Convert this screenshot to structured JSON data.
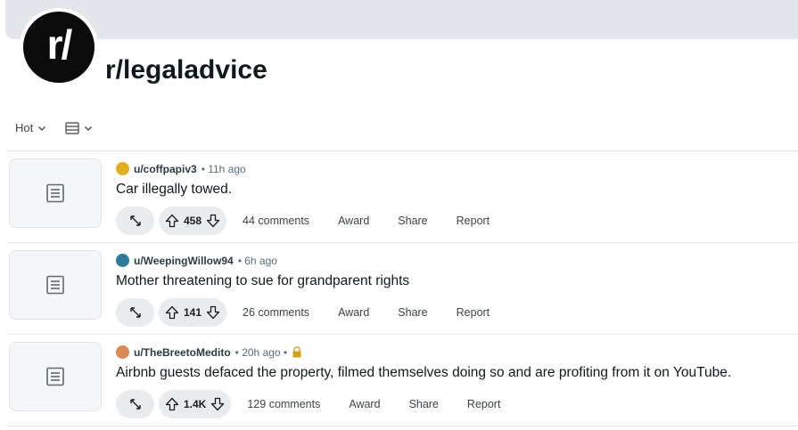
{
  "subreddit": {
    "avatar_text": "r/",
    "name": "r/legaladvice"
  },
  "controls": {
    "sort_label": "Hot",
    "view_icon": "card-view-icon"
  },
  "posts": [
    {
      "author": "u/coffpapiv3",
      "time": "• 11h ago",
      "locked": false,
      "avatar_color": "#e0b020",
      "title": "Car illegally towed.",
      "votes": "458",
      "comments": "44 comments",
      "award": "Award",
      "share": "Share",
      "report": "Report"
    },
    {
      "author": "u/WeepingWillow94",
      "time": "• 6h ago",
      "locked": false,
      "avatar_color": "#2f7a9a",
      "title": "Mother threatening to sue for grandparent rights",
      "votes": "141",
      "comments": "26 comments",
      "award": "Award",
      "share": "Share",
      "report": "Report"
    },
    {
      "author": "u/TheBreetoMedito",
      "time": "• 20h ago •",
      "locked": true,
      "avatar_color": "#d98a55",
      "title": "Airbnb guests defaced the property, filmed themselves doing so and are profiting from it on YouTube.",
      "votes": "1.4K",
      "comments": "129 comments",
      "award": "Award",
      "share": "Share",
      "report": "Report"
    }
  ],
  "colors": {
    "banner": "#e3e7ec",
    "pill": "#e8ecef",
    "lock": "#d4a017"
  }
}
